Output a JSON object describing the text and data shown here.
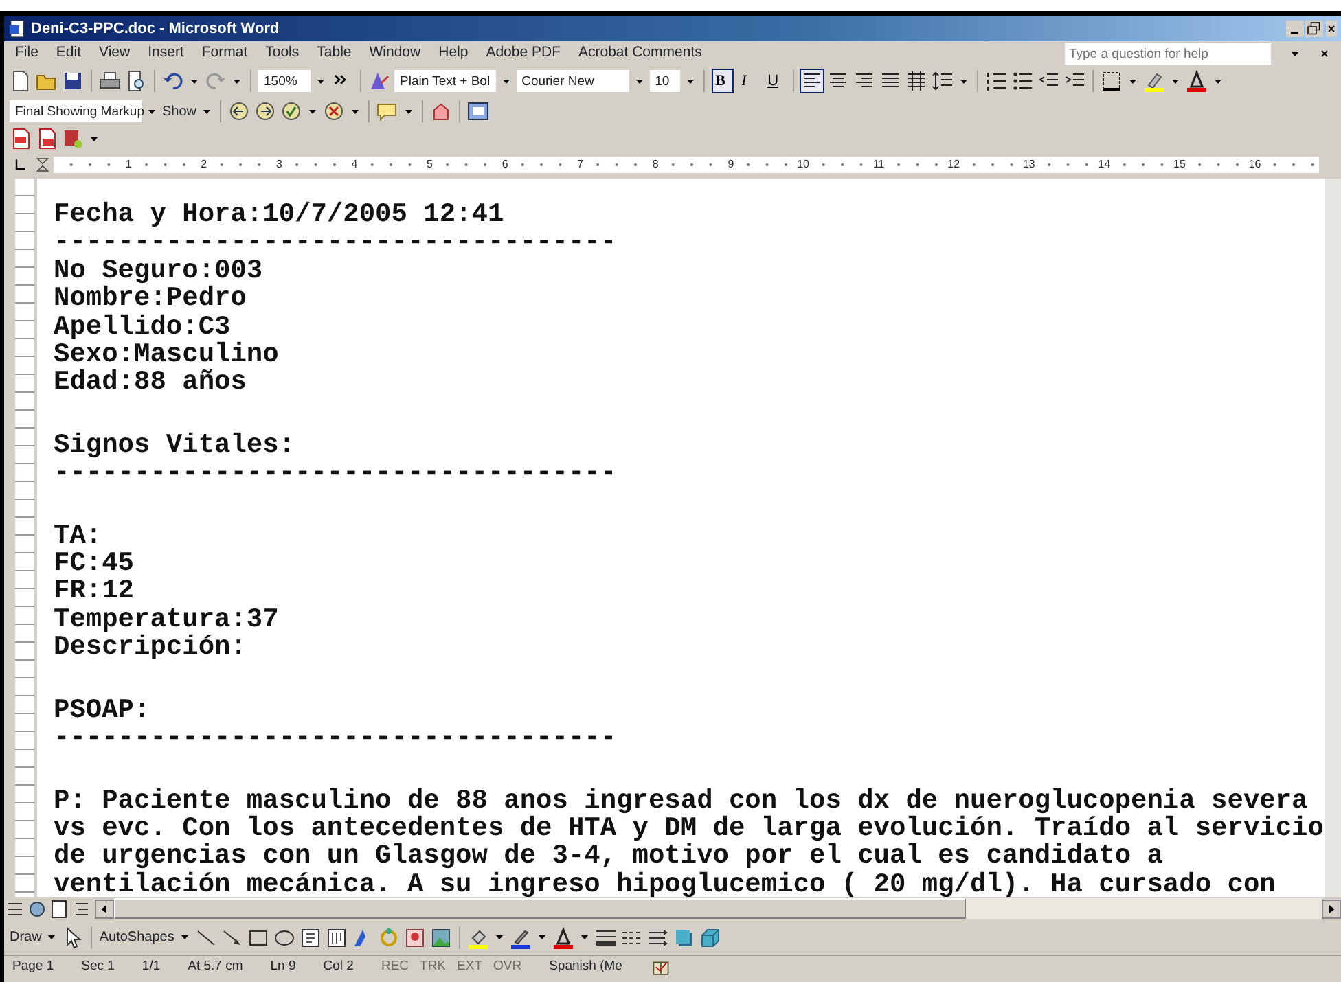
{
  "window": {
    "title": "Deni-C3-PPC.doc - Microsoft Word"
  },
  "menu": [
    "File",
    "Edit",
    "View",
    "Insert",
    "Format",
    "Tools",
    "Table",
    "Window",
    "Help",
    "Adobe PDF",
    "Acrobat Comments"
  ],
  "help_box": {
    "placeholder": "Type a question for help"
  },
  "formatting_toolbar": {
    "zoom": "150%",
    "style": "Plain Text + Bol",
    "font": "Courier New",
    "size": "10",
    "format_buttons": [
      {
        "label": "B",
        "selected": true
      },
      {
        "label": "I",
        "selected": false
      },
      {
        "label": "U",
        "selected": false
      }
    ],
    "alignment_buttons": [
      {
        "selected": true
      },
      {
        "selected": false
      },
      {
        "selected": false
      },
      {
        "selected": false
      },
      {
        "selected": false
      }
    ]
  },
  "reviewing_toolbar": {
    "display": "Final Showing Markup",
    "show": "Show"
  },
  "ruler": {
    "marks": [
      "1",
      "2",
      "3",
      "4",
      "5",
      "6",
      "7",
      "8",
      "9",
      "10",
      "11",
      "12",
      "13",
      "14",
      "15",
      "16"
    ]
  },
  "document": {
    "blocks": [
      {
        "lines": [
          "Fecha y Hora:10/7/2005 12:41",
          "-----------------------------------",
          "No Seguro:003",
          "Nombre:Pedro",
          "Apellido:C3",
          "Sexo:Masculino",
          "Edad:88 años"
        ]
      },
      {
        "lines": [
          "Signos Vitales:",
          "-----------------------------------"
        ]
      },
      {
        "lines": [
          "TA:",
          "FC:45",
          "FR:12",
          "Temperatura:37",
          "Descripción:"
        ]
      },
      {
        "lines": [
          "PSOAP:",
          "-----------------------------------"
        ]
      },
      {
        "lines": [
          "P: Paciente masculino de 88 anos ingresad con los dx de nueroglucopenia severa",
          "vs evc. Con los antecedentes de HTA y DM de larga evolución. Traído al servicio",
          "de urgencias con un Glasgow de 3-4, motivo por el cual es candidato a",
          "ventilación mecánica. A su ingreso hipoglucemico ( 20 mg/dl). Ha cursado con"
        ]
      }
    ]
  },
  "drawing_toolbar": {
    "draw": "Draw",
    "autoshapes": "AutoShapes"
  },
  "status_bar": {
    "fields": [
      "Page 1",
      "Sec 1",
      "1/1",
      "At 5.7 cm",
      "Ln 9",
      "Col 2"
    ],
    "modes": [
      {
        "label": "REC",
        "active": false
      },
      {
        "label": "TRK",
        "active": false
      },
      {
        "label": "EXT",
        "active": false
      },
      {
        "label": "OVR",
        "active": false
      }
    ],
    "language": "Spanish (Me"
  }
}
